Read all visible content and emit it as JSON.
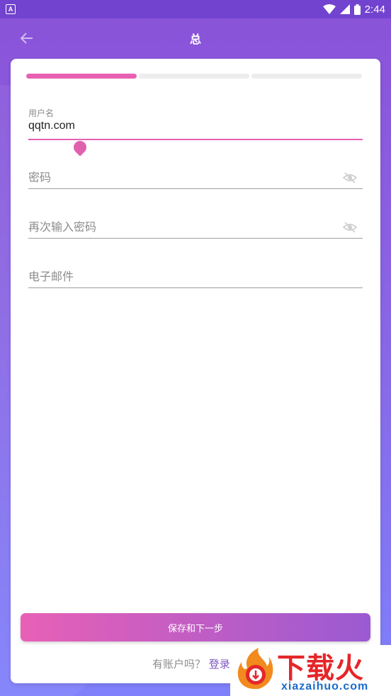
{
  "status_bar": {
    "app_icon_letter": "A",
    "time": "2:44",
    "icons": [
      "wifi-icon",
      "signal-icon",
      "battery-icon"
    ]
  },
  "app_bar": {
    "title": "总",
    "back_icon": "arrow-left-icon"
  },
  "progress": {
    "segments": 3,
    "current_step": 1,
    "fill_fraction": 1.0,
    "fill_color": "#E860B2",
    "track_color": "#EDEDED"
  },
  "form": {
    "username": {
      "label": "用户名",
      "value": "qqtn.com"
    },
    "password": {
      "placeholder": "密码",
      "toggle_icon": "eye-off-icon"
    },
    "confirm_password": {
      "placeholder": "再次输入密码",
      "toggle_icon": "eye-off-icon"
    },
    "email": {
      "placeholder": "电子邮件"
    }
  },
  "actions": {
    "submit_label": "保存和下一步",
    "login_prompt": "有账户吗？",
    "login_link": "登录"
  },
  "watermark": {
    "brand": "下载火",
    "domain": "xiazaihuo.com"
  },
  "colors": {
    "accent": "#E860B2",
    "header_bg": "#8A52D8",
    "link": "#7E57C2",
    "button_gradient_start": "#E860B6",
    "button_gradient_end": "#9B5AD2"
  }
}
